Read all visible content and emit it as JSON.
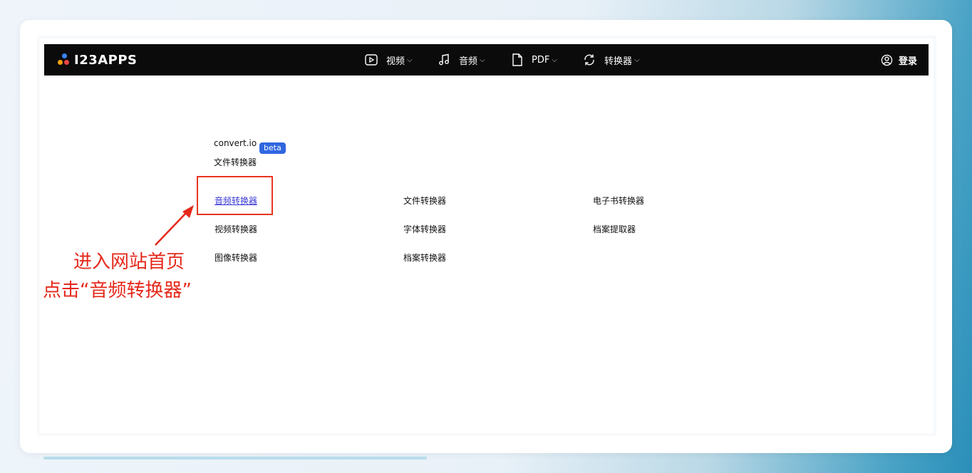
{
  "header": {
    "logo_text": "I23APPS",
    "nav": [
      {
        "label": "视频",
        "icon": "play-video-icon"
      },
      {
        "label": "音频",
        "icon": "music-note-icon"
      },
      {
        "label": "PDF",
        "icon": "file-icon"
      },
      {
        "label": "转换器",
        "icon": "convert-cycle-icon"
      }
    ],
    "login_label": "登录",
    "login_icon": "user-circle-icon"
  },
  "main": {
    "brand": "convert.io",
    "beta_badge": "beta",
    "subtitle": "文件转换器",
    "links": {
      "audio_converter": "音频转换器",
      "video_converter": "视频转换器",
      "image_converter": "图像转换器",
      "file_converter": "文件转换器",
      "font_converter": "字体转换器",
      "archive_converter": "档案转换器",
      "ebook_converter": "电子书转换器",
      "archive_extractor": "档案提取器"
    }
  },
  "annotation": {
    "line1": "进入网站首页",
    "line2": "点击“音频转换器”"
  },
  "colors": {
    "topbar": "#0b0b0c",
    "badge": "#3066e0",
    "annotation": "#e5281b",
    "active_link": "#3a3ad6"
  }
}
